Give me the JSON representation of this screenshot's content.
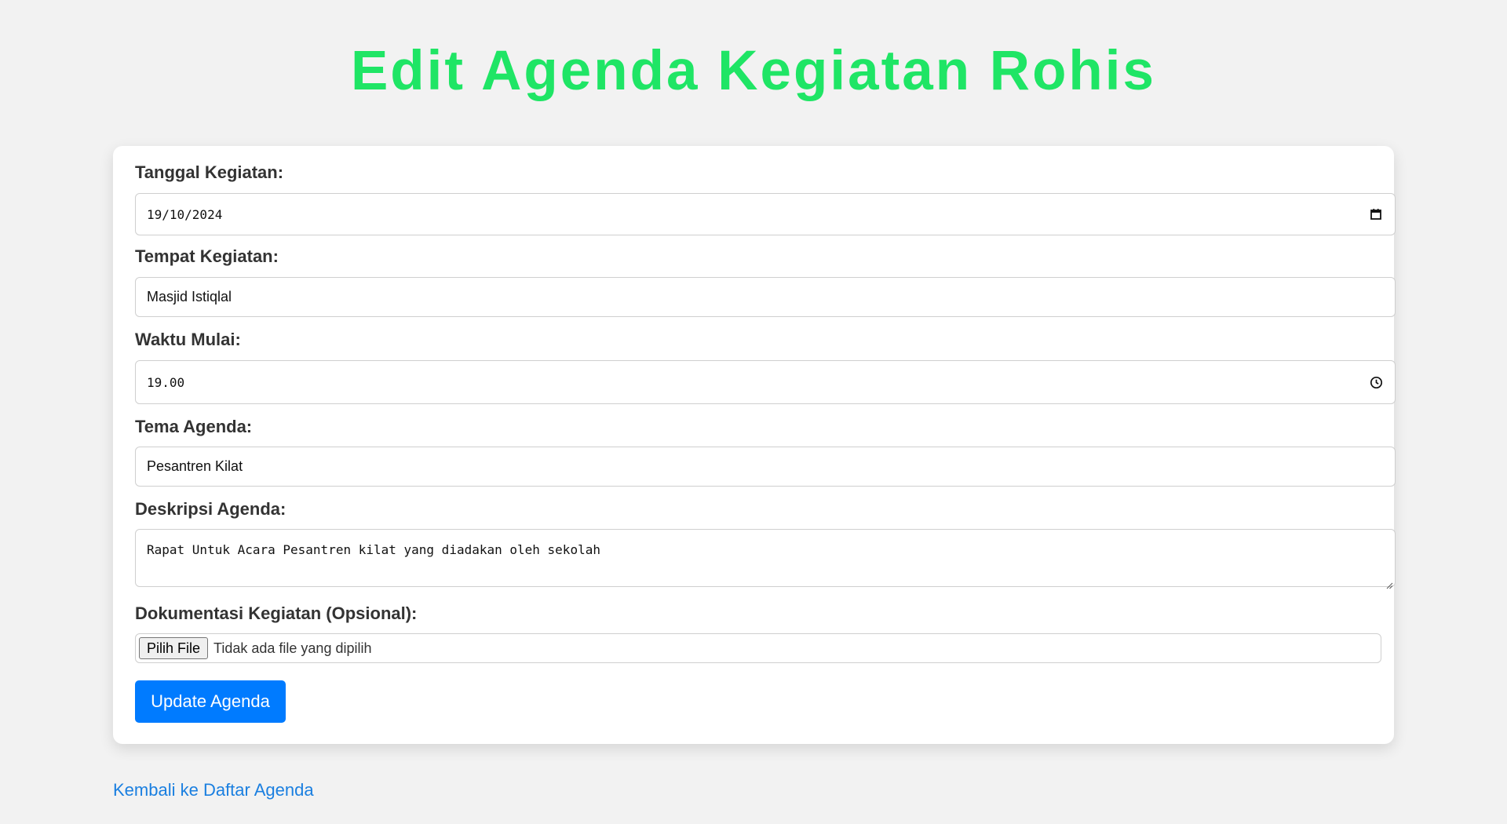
{
  "page": {
    "title": "Edit Agenda Kegiatan Rohis"
  },
  "form": {
    "date": {
      "label": "Tanggal Kegiatan:",
      "value": "19/10/2024",
      "icon": "calendar-icon"
    },
    "place": {
      "label": "Tempat Kegiatan:",
      "value": "Masjid Istiqlal"
    },
    "time": {
      "label": "Waktu Mulai:",
      "value": "19.00",
      "icon": "clock-icon"
    },
    "theme": {
      "label": "Tema Agenda:",
      "value": "Pesantren Kilat"
    },
    "description": {
      "label": "Deskripsi Agenda:",
      "value": "Rapat Untuk Acara Pesantren kilat yang diadakan oleh sekolah"
    },
    "documentation": {
      "label": "Dokumentasi Kegiatan (Opsional):",
      "button_label": "Pilih File",
      "status": "Tidak ada file yang dipilih"
    },
    "submit_label": "Update Agenda"
  },
  "footer": {
    "back_link": "Kembali ke Daftar Agenda"
  },
  "colors": {
    "title": "#1fe565",
    "button": "#007bff",
    "link": "#1a7fe0",
    "background": "#f2f2f2"
  }
}
